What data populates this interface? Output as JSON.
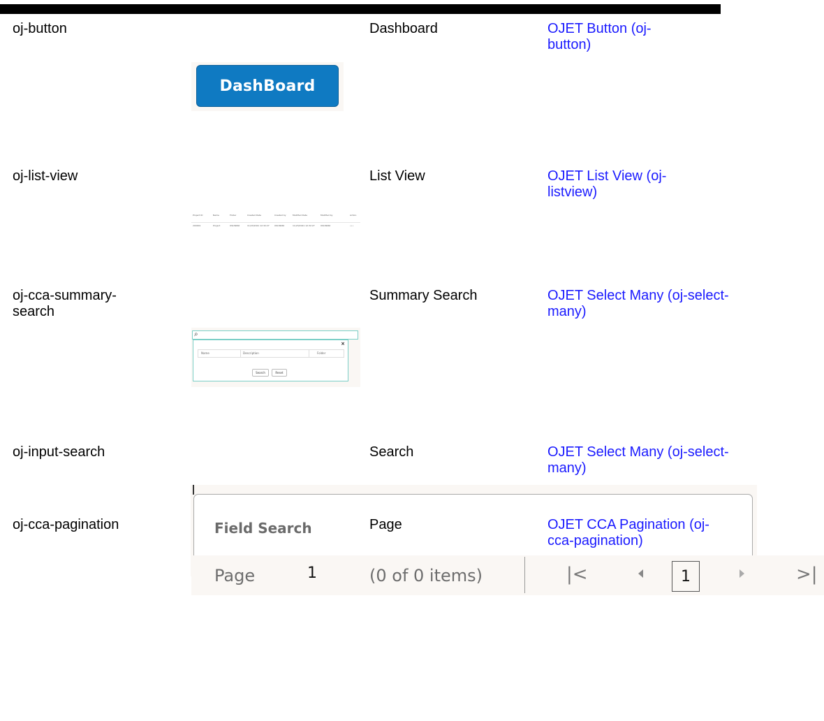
{
  "rows": [
    {
      "component": "oj-button",
      "label": "Dashboard",
      "link": "OJET Button (oj-button)"
    },
    {
      "component": "oj-list-view",
      "label": "List View",
      "link": "OJET List View (oj-listview)"
    },
    {
      "component": "oj-cca-summary-search",
      "label": "Summary Search",
      "link": "OJET Select Many (oj-select-many)"
    },
    {
      "component": "oj-input-search",
      "label": "Search",
      "link": "OJET Select Many (oj-select-many)"
    },
    {
      "component": "oj-cca-pagination",
      "label": "Page",
      "link": "OJET CCA Pagination (oj-cca-pagination)"
    }
  ],
  "dashboard_button": {
    "label": "DashBoard",
    "color": "#0f7ac2"
  },
  "list_view": {
    "headers": [
      "Project ID",
      "Name",
      "Folder",
      "Created Date",
      "Created by",
      "Modified Date",
      "Modified by",
      "Action"
    ],
    "row": [
      "200001",
      "Project",
      "OSUSR60",
      "11/23/2021 12:32:27",
      "OSUSR60",
      "11/23/2021 12:32:27",
      "OSUSR60",
      "•••"
    ]
  },
  "summary_search": {
    "close": "×",
    "columns": [
      "Name",
      "Description",
      "Folder"
    ],
    "search_button": "Search",
    "reset_button": "Reset"
  },
  "input_search": {
    "placeholder": "Field Search"
  },
  "pagination": {
    "page_label": "Page",
    "page_value": "1",
    "items_text": "(0 of 0 items)",
    "current_page": "1"
  },
  "colors": {
    "link": "#1a1aff",
    "accent": "#7ccfc7"
  }
}
